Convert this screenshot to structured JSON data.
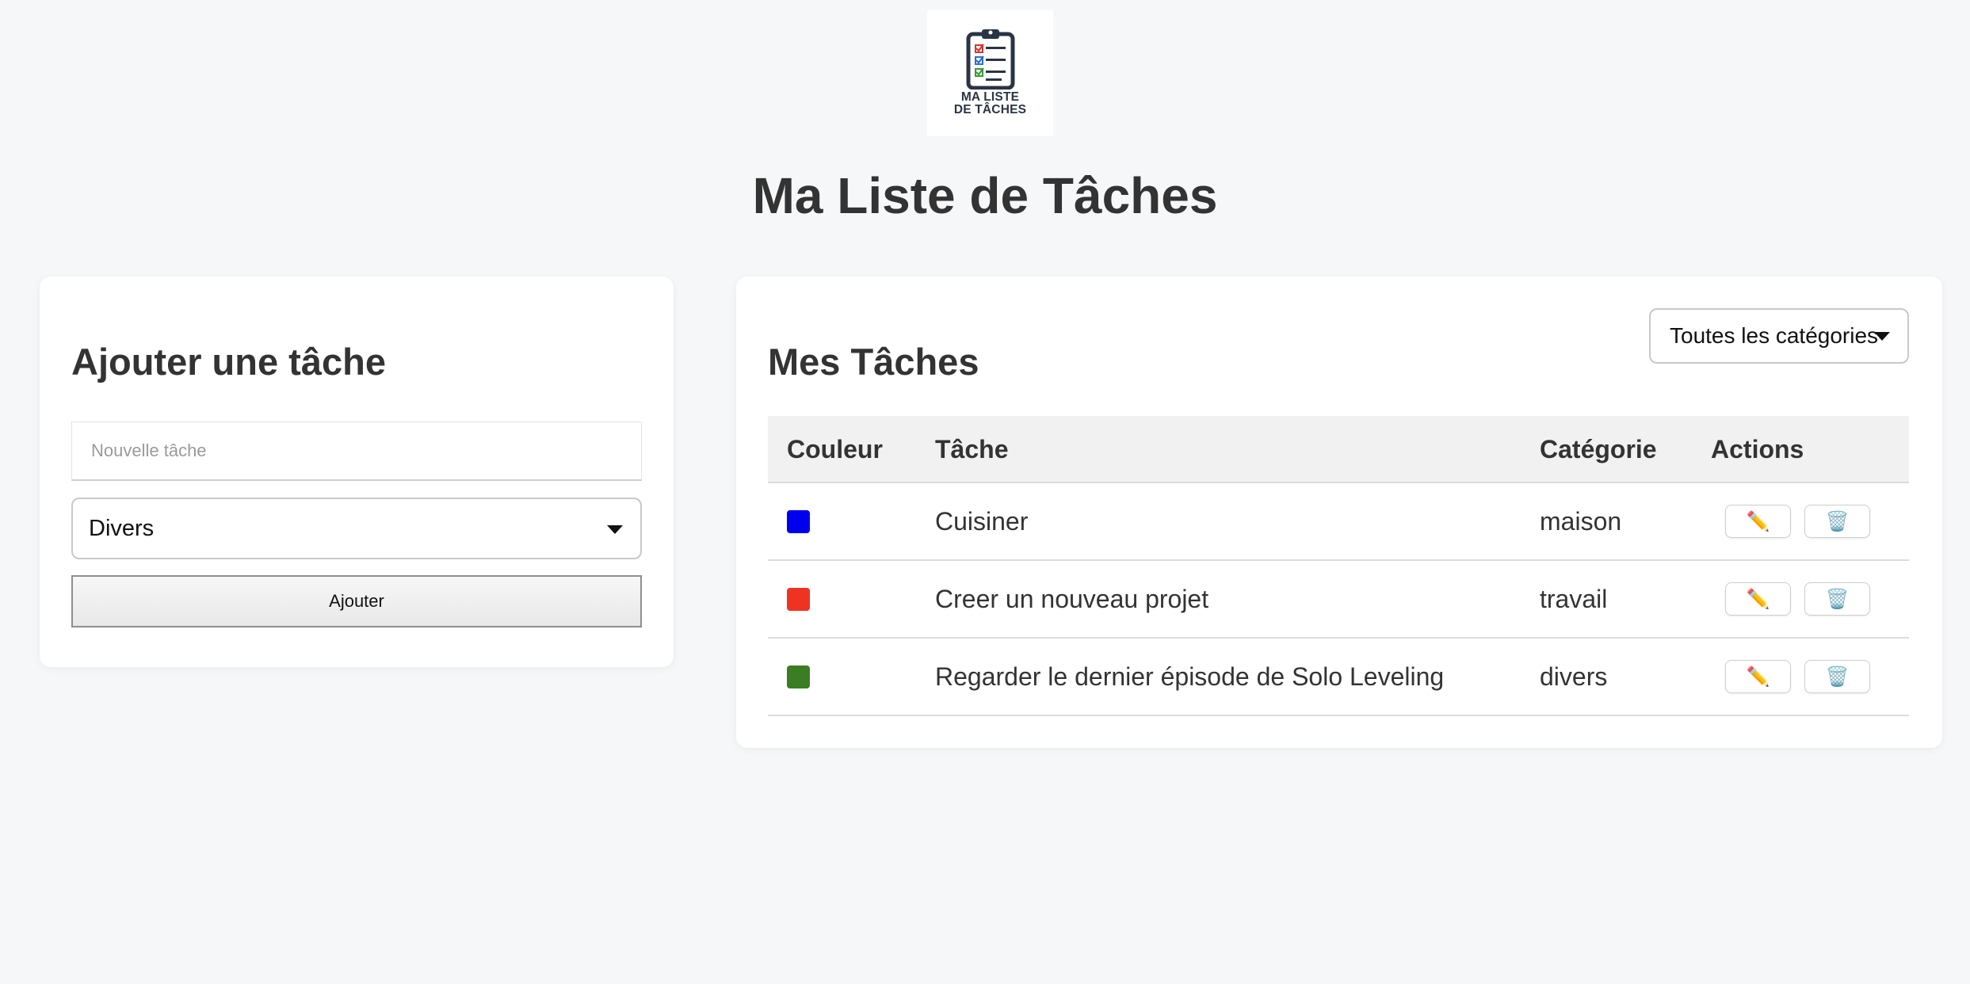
{
  "logo": {
    "line1": "MA LISTE",
    "line2": "DE TÂCHES"
  },
  "page_title": "Ma Liste de Tâches",
  "add_card": {
    "title": "Ajouter une tâche",
    "input_placeholder": "Nouvelle tâche",
    "category_selected": "Divers",
    "add_button": "Ajouter"
  },
  "list_card": {
    "title": "Mes Tâches",
    "filter_selected": "Toutes les catégories",
    "columns": [
      "Couleur",
      "Tâche",
      "Catégorie",
      "Actions"
    ],
    "rows": [
      {
        "color": "#0000ee",
        "task": "Cuisiner",
        "category": "maison",
        "edit_icon": "pencil-icon",
        "delete_icon": "trash-icon"
      },
      {
        "color": "#ee3322",
        "task": "Creer un nouveau projet",
        "category": "travail",
        "edit_icon": "pencil-icon",
        "delete_icon": "trash-icon"
      },
      {
        "color": "#3a7d22",
        "task": "Regarder le dernier épisode de Solo Leveling",
        "category": "divers",
        "edit_icon": "pencil-icon",
        "delete_icon": "trash-icon"
      }
    ]
  }
}
